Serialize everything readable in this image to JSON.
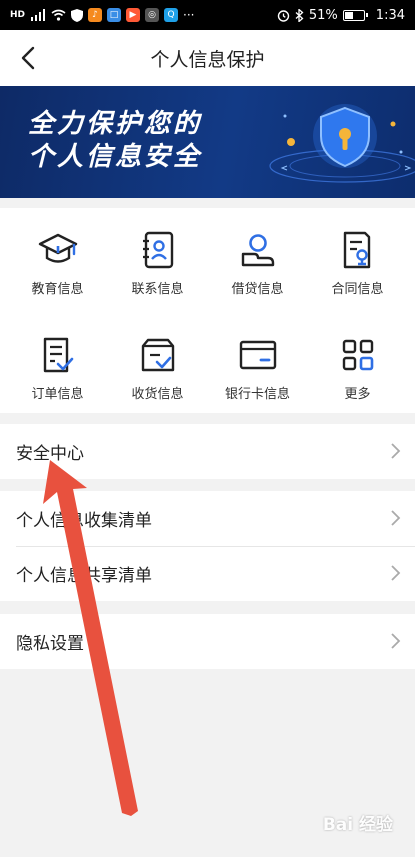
{
  "status_bar": {
    "left_icons": [
      "hd-icon",
      "signal-icon",
      "wifi-icon",
      "shield-icon",
      "app-icon-orange",
      "app-icon-blue",
      "app-icon-play",
      "app-icon-green",
      "app-icon-search"
    ],
    "more": "···",
    "battery": "51%",
    "time": "1:34"
  },
  "nav": {
    "title": "个人信息保护"
  },
  "banner": {
    "line1": "全力保护您的",
    "line2": "个人信息安全"
  },
  "grid": {
    "items": [
      {
        "label": "教育信息",
        "icon": "graduation-cap-icon"
      },
      {
        "label": "联系信息",
        "icon": "contacts-book-icon"
      },
      {
        "label": "借贷信息",
        "icon": "loan-hand-icon"
      },
      {
        "label": "合同信息",
        "icon": "contract-icon"
      },
      {
        "label": "订单信息",
        "icon": "order-list-icon"
      },
      {
        "label": "收货信息",
        "icon": "delivery-box-icon"
      },
      {
        "label": "银行卡信息",
        "icon": "bank-card-icon"
      },
      {
        "label": "更多",
        "icon": "more-grid-icon"
      }
    ]
  },
  "list": {
    "security_center": "安全中心",
    "collection_list": "个人信息收集清单",
    "sharing_list": "个人信息共享清单",
    "privacy_settings": "隐私设置"
  },
  "colors": {
    "accent": "#2f6fe4",
    "banner_bg": "#123a86",
    "annotation_arrow": "#e8513e"
  },
  "watermark": "Bai 经验"
}
